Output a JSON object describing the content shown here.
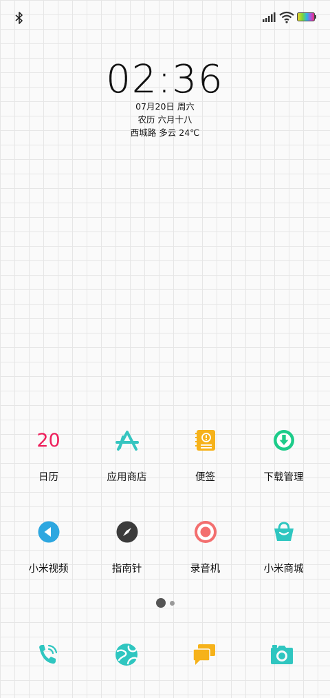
{
  "status_bar": {
    "icons": [
      "bluetooth-icon",
      "cellular-signal-icon",
      "wifi-icon",
      "battery-icon"
    ]
  },
  "lockscreen_clock": {
    "time": "02:36",
    "date": "07月20日 周六",
    "lunar": "农历 六月十八",
    "weather": "西城路 多云 24℃"
  },
  "apps": {
    "row1": [
      {
        "label": "日历",
        "icon": "calendar-icon",
        "icon_text": "20",
        "color": "#ee1f5b"
      },
      {
        "label": "应用商店",
        "icon": "app-store-icon",
        "color": "#35c5c0"
      },
      {
        "label": "便签",
        "icon": "notes-icon",
        "color": "#f6b21a"
      },
      {
        "label": "下载管理",
        "icon": "download-icon",
        "color": "#1dcc8a"
      }
    ],
    "row2": [
      {
        "label": "小米视频",
        "icon": "video-play-icon",
        "color": "#2da7e0"
      },
      {
        "label": "指南针",
        "icon": "compass-icon",
        "color": "#3b3b3b"
      },
      {
        "label": "录音机",
        "icon": "recorder-icon",
        "color": "#f36f6f"
      },
      {
        "label": "小米商城",
        "icon": "shopping-bag-icon",
        "color": "#2fc6c0"
      }
    ]
  },
  "page_indicator": {
    "pages": 2,
    "current": 1
  },
  "dock": [
    {
      "icon": "phone-icon",
      "color": "#2fc6c0"
    },
    {
      "icon": "browser-globe-icon",
      "color": "#2fc6c0"
    },
    {
      "icon": "messages-icon",
      "color": "#f6b21a"
    },
    {
      "icon": "camera-icon",
      "color": "#2fc6c0"
    }
  ]
}
